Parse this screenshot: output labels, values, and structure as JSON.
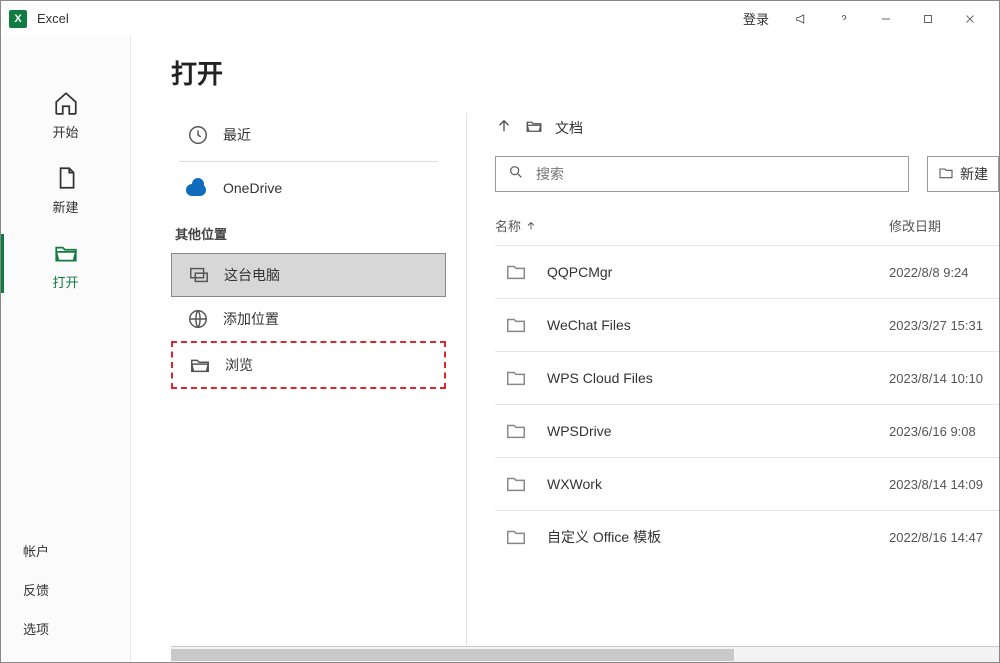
{
  "titlebar": {
    "app_name": "Excel",
    "login": "登录"
  },
  "nav": {
    "home": "开始",
    "new": "新建",
    "open": "打开",
    "account": "帐户",
    "feedback": "反馈",
    "options": "选项"
  },
  "page": {
    "title": "打开"
  },
  "sources": {
    "recent": "最近",
    "onedrive": "OneDrive",
    "other_header": "其他位置",
    "this_pc": "这台电脑",
    "add_place": "添加位置",
    "browse": "浏览"
  },
  "browse": {
    "breadcrumb": "文档",
    "search_placeholder": "搜索",
    "new_button": "新建",
    "col_name": "名称",
    "col_date": "修改日期",
    "items": [
      {
        "name": "QQPCMgr",
        "date": "2022/8/8 9:24"
      },
      {
        "name": "WeChat Files",
        "date": "2023/3/27 15:31"
      },
      {
        "name": "WPS Cloud Files",
        "date": "2023/8/14 10:10"
      },
      {
        "name": "WPSDrive",
        "date": "2023/6/16 9:08"
      },
      {
        "name": "WXWork",
        "date": "2023/8/14 14:09"
      },
      {
        "name": "自定义 Office 模板",
        "date": "2022/8/16 14:47"
      }
    ]
  }
}
